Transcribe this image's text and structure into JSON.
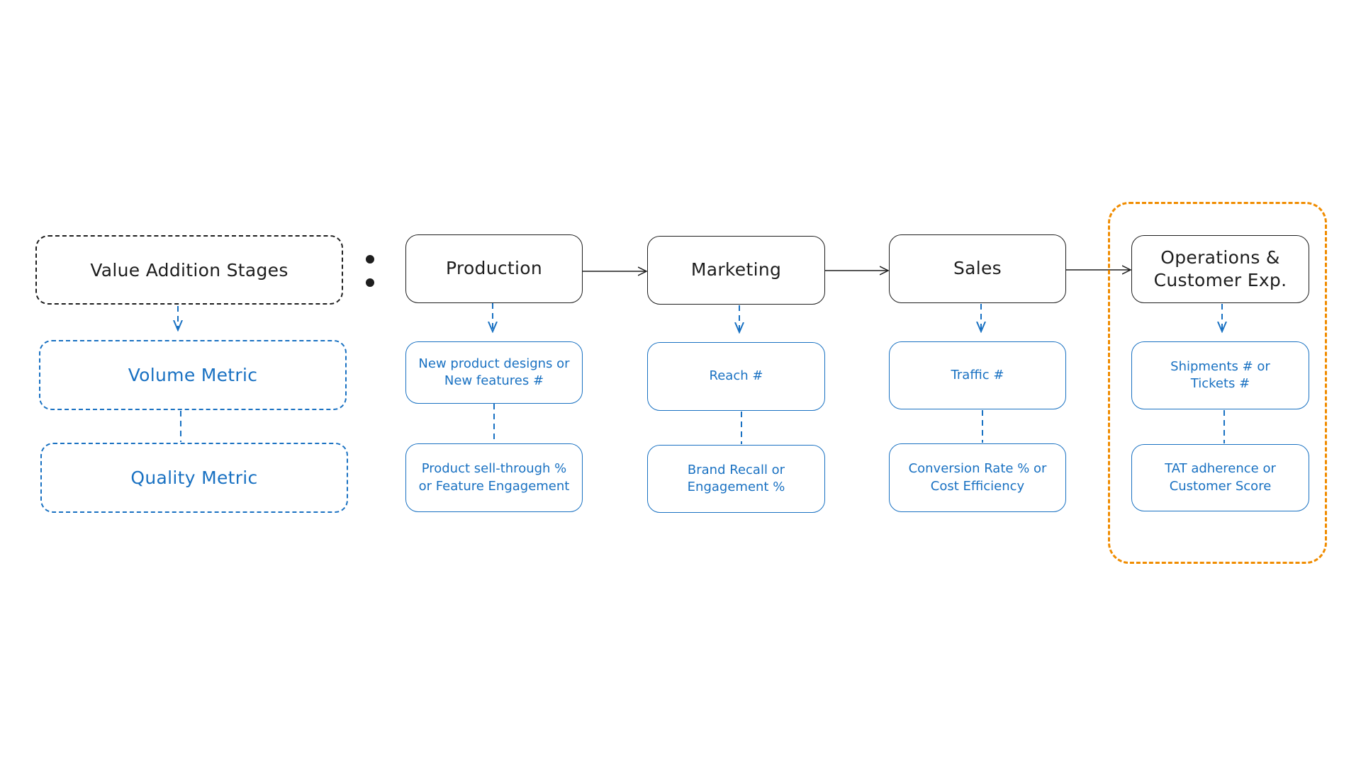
{
  "diagram": {
    "type": "flowchart",
    "legend": {
      "stage_label": "Value Addition Stages",
      "volume_label": "Volume Metric",
      "quality_label": "Quality Metric",
      "separator": ":"
    },
    "stages": [
      {
        "name": "Production",
        "volume_metric": "New product designs or\nNew features #",
        "quality_metric": "Product sell-through %\nor Feature Engagement"
      },
      {
        "name": "Marketing",
        "volume_metric": "Reach #",
        "quality_metric": "Brand Recall or\nEngagement %"
      },
      {
        "name": "Sales",
        "volume_metric": "Traffic #",
        "quality_metric": "Conversion Rate % or\nCost Efficiency"
      },
      {
        "name": "Operations &\nCustomer Exp.",
        "volume_metric": "Shipments # or\nTickets #",
        "quality_metric": "TAT adherence or\nCustomer Score",
        "highlighted": true
      }
    ],
    "colors": {
      "stage_stroke": "#1e1e1e",
      "metric_stroke": "#1971c2",
      "highlight_stroke": "#f08c00",
      "background": "#ffffff"
    }
  }
}
